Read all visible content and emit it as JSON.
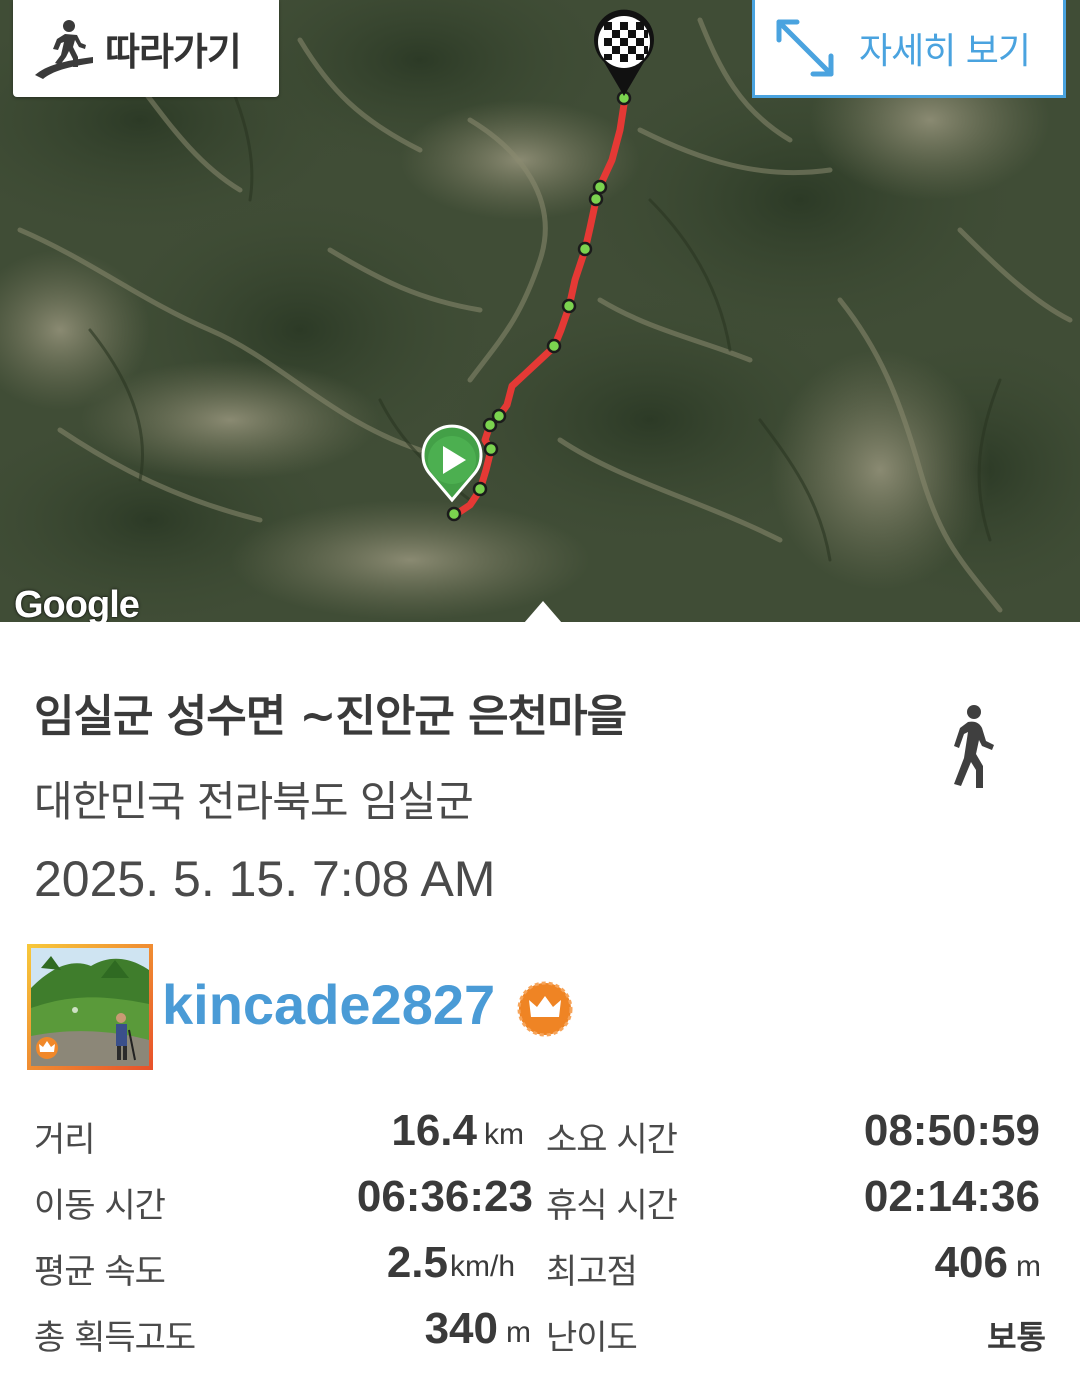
{
  "map": {
    "follow_button": {
      "label": "따라가기",
      "icon": "walker-on-path-icon"
    },
    "detail_button": {
      "label": "자세히 보기",
      "icon": "expand-arrows-icon"
    },
    "attribution": "Google",
    "route_color": "#e53935",
    "start_marker": "play-icon",
    "end_marker": "checkered-flag-icon"
  },
  "record": {
    "title": "임실군 성수면 ~진안군 은천마을",
    "region": "대한민국 전라북도 임실군",
    "datetime": "2025. 5. 15. 7:08 AM",
    "activity_icon": "walking-person-icon"
  },
  "user": {
    "name": "kincade2827",
    "badge": "crown-icon",
    "name_color": "#4a9bd6"
  },
  "stats": {
    "distance": {
      "label": "거리",
      "value": "16.4",
      "unit": "km"
    },
    "total_time": {
      "label": "소요 시간",
      "value": "08:50:59",
      "unit": ""
    },
    "moving_time": {
      "label": "이동 시간",
      "value": "06:36:23",
      "unit": ""
    },
    "rest_time": {
      "label": "휴식 시간",
      "value": "02:14:36",
      "unit": ""
    },
    "avg_speed": {
      "label": "평균 속도",
      "value": "2.5",
      "unit": "km/h"
    },
    "max_altitude": {
      "label": "최고점",
      "value": "406",
      "unit": "m"
    },
    "total_ascent": {
      "label": "총 획득고도",
      "value": "340",
      "unit": "m"
    },
    "difficulty": {
      "label": "난이도",
      "value": "보통",
      "unit": ""
    }
  }
}
